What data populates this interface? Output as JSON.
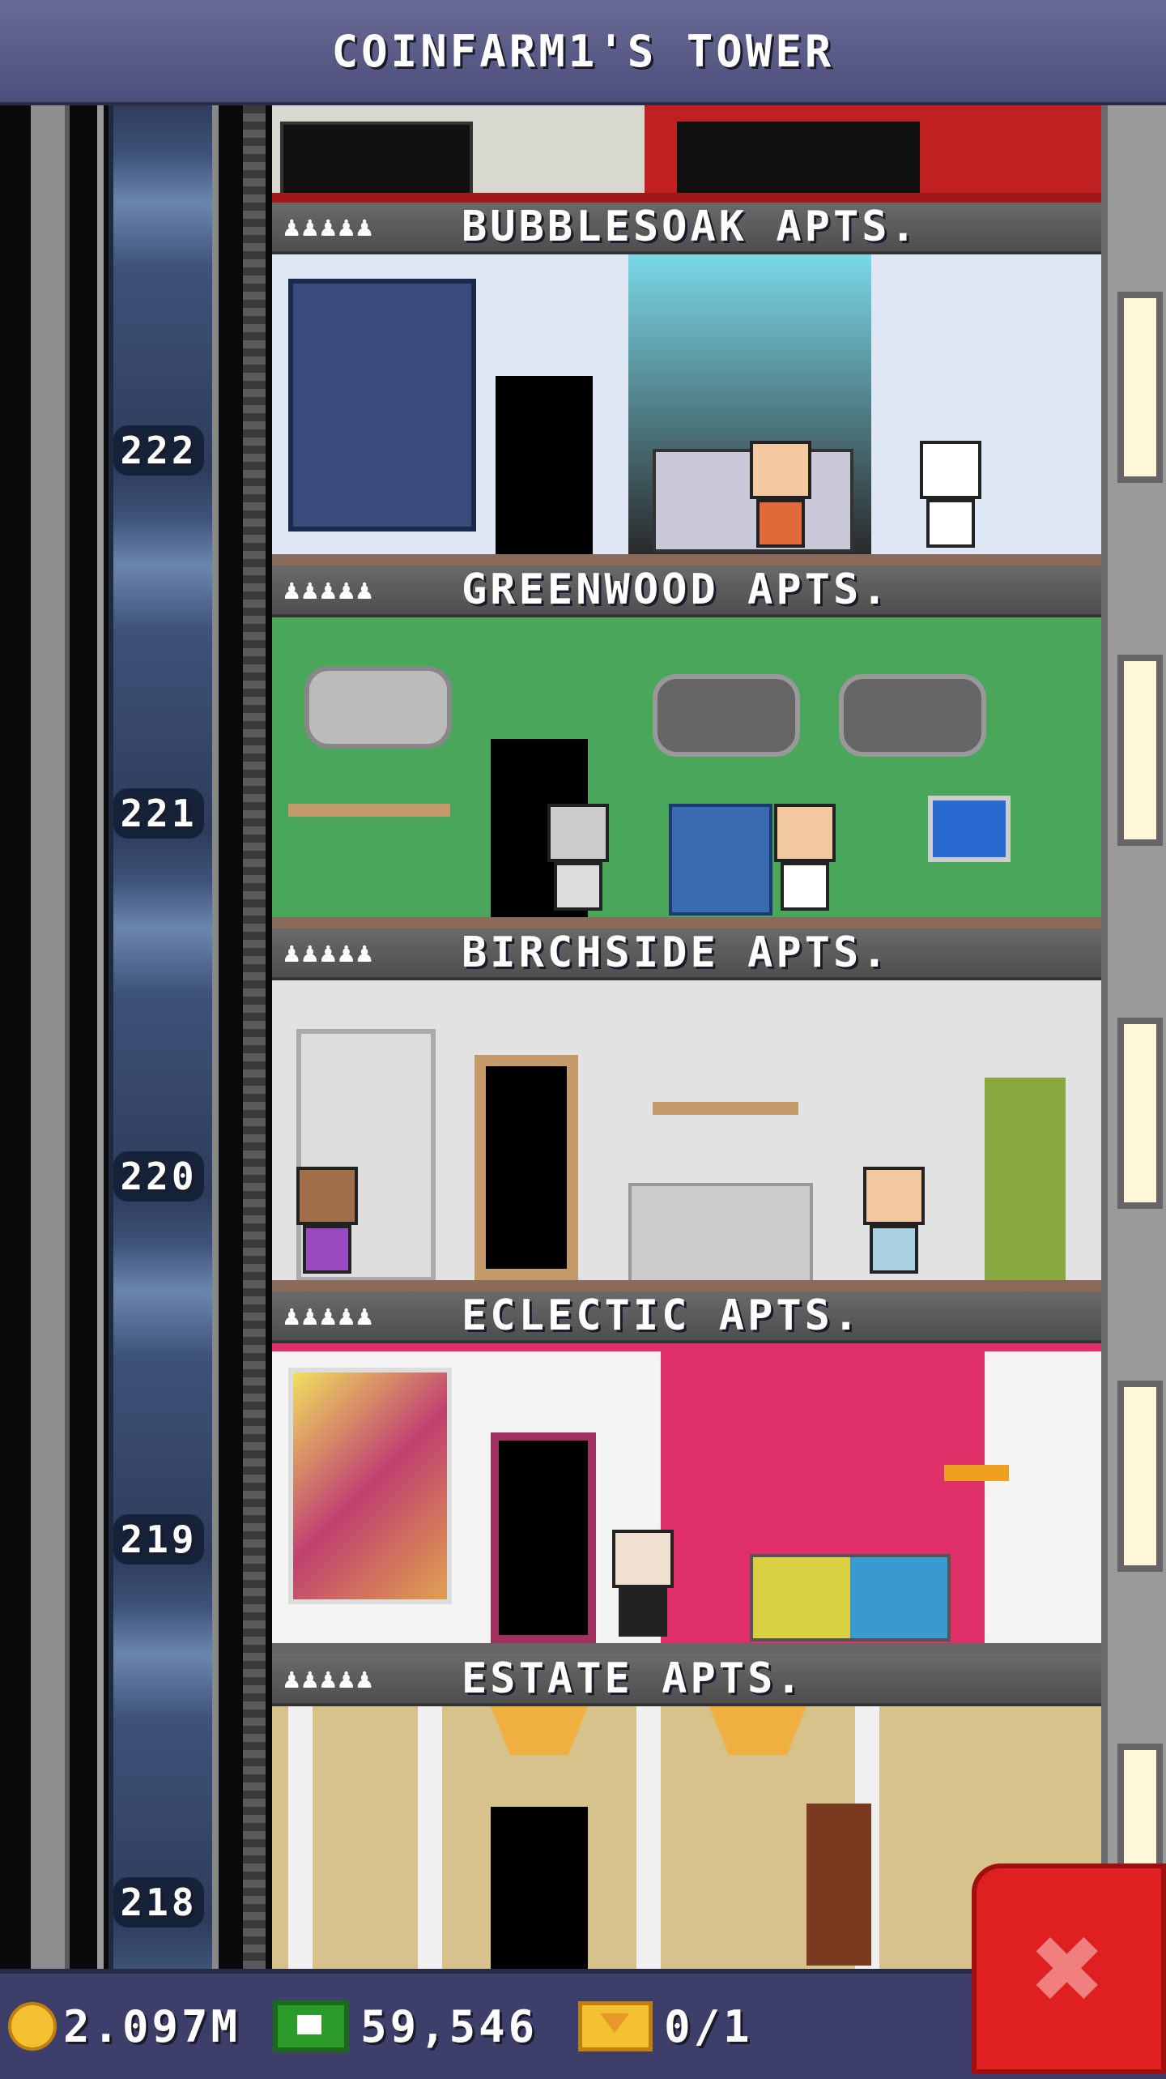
{
  "header": {
    "title": "COINFARM1'S TOWER"
  },
  "floor_numbers": [
    "222",
    "221",
    "220",
    "219",
    "218"
  ],
  "floors": [
    {
      "name": "BUBBLESOAK APTS.",
      "residents": "♟♟♟♟♟",
      "wall": "#dfe6f4",
      "accent": "#4a6a9a"
    },
    {
      "name": "GREENWOOD APTS.",
      "residents": "♟♟♟♟♟",
      "wall": "#4aa65a",
      "accent": "#2a7a3a"
    },
    {
      "name": "BIRCHSIDE APTS.",
      "residents": "♟♟♟♟♟",
      "wall": "#e2e2e2",
      "accent": "#c49a6a"
    },
    {
      "name": "ECLECTIC APTS.",
      "residents": "♟♟♟♟♟",
      "wall": "#f4f4f4",
      "accent": "#e0306a"
    },
    {
      "name": "ESTATE APTS.",
      "residents": "♟♟♟♟♟",
      "wall": "#d6c28a",
      "accent": "#f0f0f0"
    }
  ],
  "status": {
    "coins": "2.097M",
    "bux": "59,546",
    "tickets": "0/1"
  },
  "colors": {
    "coin": "#f2c030",
    "bux": "#2a9a2a",
    "close": "#e02020"
  },
  "icons": {
    "coins": "coin-icon",
    "bux": "bux-icon",
    "tickets": "ticket-icon",
    "close": "close-icon"
  }
}
